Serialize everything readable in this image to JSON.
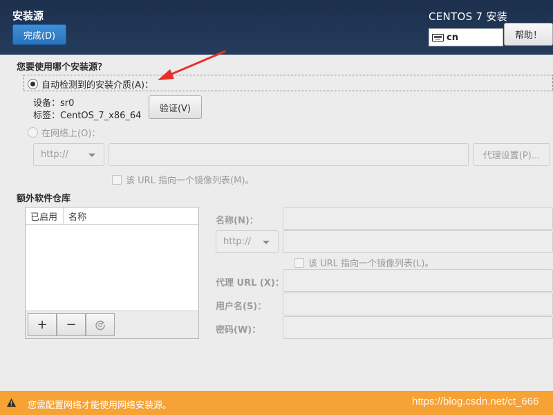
{
  "header": {
    "spoke_title": "安装源",
    "done_label": "完成(D)",
    "product_title": "CENTOS 7 安装",
    "keyboard_layout": "cn",
    "help_label": "帮助！"
  },
  "source": {
    "question": "您要使用哪个安装源？",
    "auto_label": "自动检测到的安装介质(A)：",
    "auto_selected": true,
    "device_label": "设备：sr0",
    "tag_label": "标签：CentOS_7_x86_64",
    "verify_label": "验证(V)",
    "network_label": "在网络上(O)：",
    "protocol_value": "http://",
    "proxy_label": "代理设置(P)...",
    "mirror_checkbox_label": "该 URL 指向一个镜像列表(M)。"
  },
  "repos": {
    "section_title": "额外软件仓库",
    "columns": [
      "已启用",
      "名称"
    ],
    "add_label": "+",
    "remove_label": "−",
    "name_label": "名称(N)：",
    "protocol_value": "http://",
    "mirror_checkbox_label": "该 URL 指向一个镜像列表(L)。",
    "proxy_url_label": "代理 URL (X)：",
    "username_label": "用户名(S)：",
    "password_label": "密码(W)："
  },
  "footer": {
    "warning": "您需配置网络才能使用网络安装源。",
    "watermark": "https://blog.csdn.net/ct_666"
  },
  "colors": {
    "header_bg": "#1c2f4d",
    "done_button": "#2f7cc8",
    "footer_bg": "#f6a234",
    "annotation_arrow": "#e8302a"
  }
}
